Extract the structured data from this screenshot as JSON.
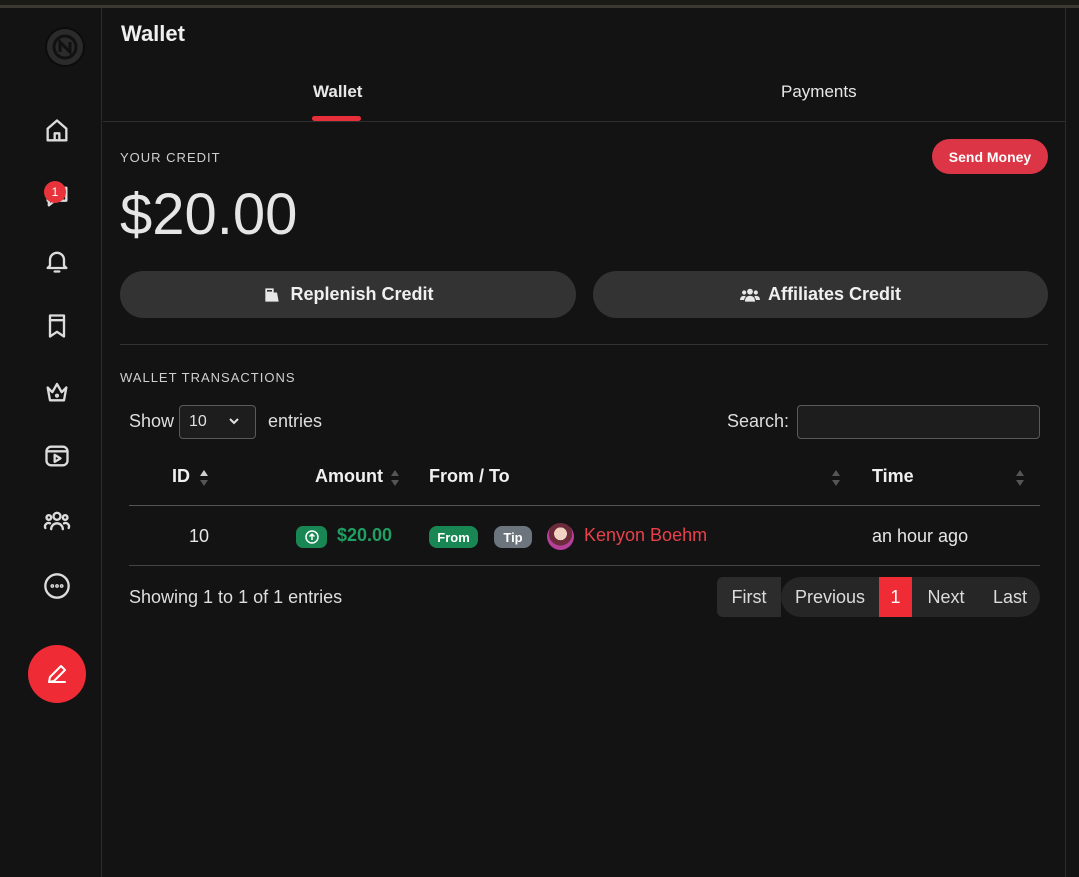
{
  "sidebar": {
    "badge_count": "1",
    "items": [
      "home-icon",
      "messages-icon",
      "bell-icon",
      "bookmark-icon",
      "crown-icon",
      "video-icon",
      "users-icon",
      "more-icon"
    ],
    "compose_icon": "pencil-icon"
  },
  "page": {
    "title": "Wallet"
  },
  "tabs": [
    {
      "label": "Wallet",
      "active": true
    },
    {
      "label": "Payments",
      "active": false
    }
  ],
  "credit": {
    "label": "YOUR CREDIT",
    "amount": "$20.00",
    "send_money_label": "Send Money",
    "replenish_label": "Replenish Credit",
    "affiliates_label": "Affiliates Credit"
  },
  "transactions": {
    "section_label": "WALLET TRANSACTIONS",
    "show_label": "Show",
    "entries_label": "entries",
    "page_size": "10",
    "search_label": "Search:",
    "search_value": "",
    "columns": [
      "ID",
      "Amount",
      "From / To",
      "Time"
    ],
    "rows": [
      {
        "id": "10",
        "amount": "$20.00",
        "direction_tag": "From",
        "type_tag": "Tip",
        "user": "Kenyon Boehm",
        "time": "an hour ago"
      }
    ],
    "summary": "Showing 1 to 1 of 1 entries",
    "pagination": {
      "first": "First",
      "previous": "Previous",
      "current": "1",
      "next": "Next",
      "last": "Last"
    }
  },
  "colors": {
    "accent": "#ef2c36",
    "success": "#198754",
    "secondary": "#6c757d",
    "background": "#131313"
  }
}
